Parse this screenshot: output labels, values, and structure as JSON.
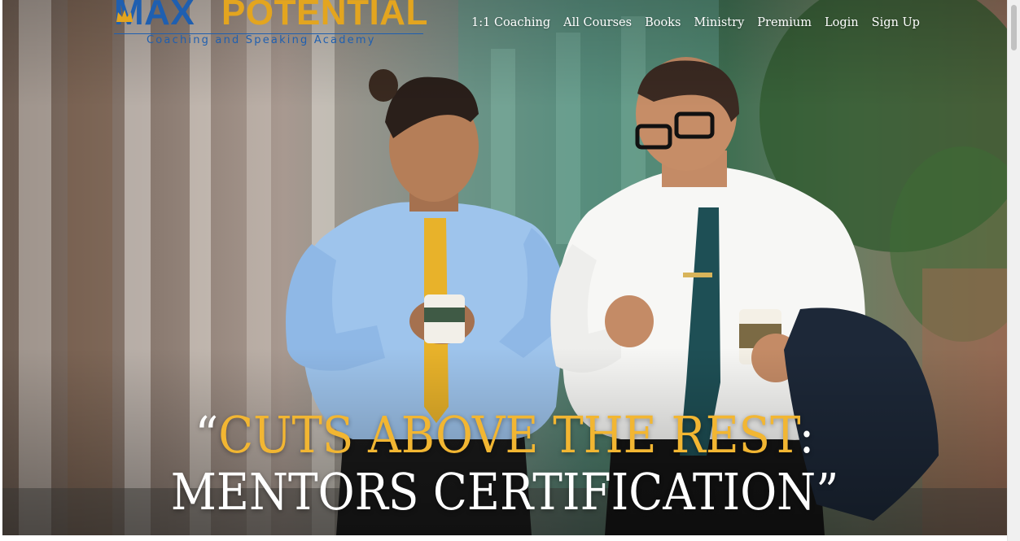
{
  "logo": {
    "word1": "MAX",
    "word2": "POTENTIAL",
    "tagline": "Coaching and Speaking Academy",
    "primary_color": "#1f5fb0",
    "accent_color": "#e3a51f"
  },
  "nav": {
    "items": [
      {
        "label": "1:1 Coaching"
      },
      {
        "label": "All Courses"
      },
      {
        "label": "Books"
      },
      {
        "label": "Ministry"
      },
      {
        "label": "Premium"
      },
      {
        "label": "Login"
      },
      {
        "label": "Sign Up"
      }
    ]
  },
  "hero": {
    "headline_open_quote": "“",
    "headline_line1": "CUTS ABOVE THE REST",
    "headline_colon": ":",
    "headline_line2": "MENTORS CERTIFICATION",
    "headline_close_quote": "”",
    "gold_color": "#f2b632",
    "image_description_icon": "two-businessmen-walking-photo"
  }
}
